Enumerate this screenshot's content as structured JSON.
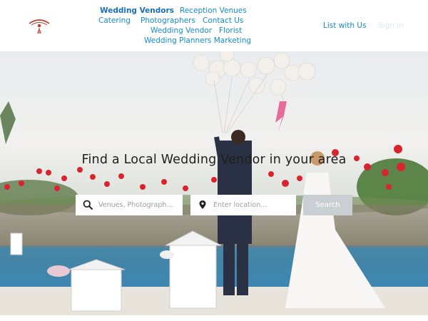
{
  "header": {
    "nav": {
      "wedding_vendors": "Wedding Vendors",
      "reception_venues": "Reception Venues",
      "catering": "Catering",
      "photographers": "Photographers",
      "contact_us": "Contact Us",
      "wedding_vendor": "Wedding Vendor",
      "florist": "Florist",
      "wedding_planners_marketing": "Wedding Planners Marketing"
    },
    "list_with_us": "List with Us",
    "sign_in": "Sign in"
  },
  "hero": {
    "title": "Find a Local Wedding Vendor in your area",
    "search_what_placeholder": "Venues, Photograph...",
    "search_where_placeholder": "Enter location...",
    "search_button": "Search"
  },
  "colors": {
    "link": "#1a8bc7",
    "search_button_bg": "#c9cfd3"
  }
}
